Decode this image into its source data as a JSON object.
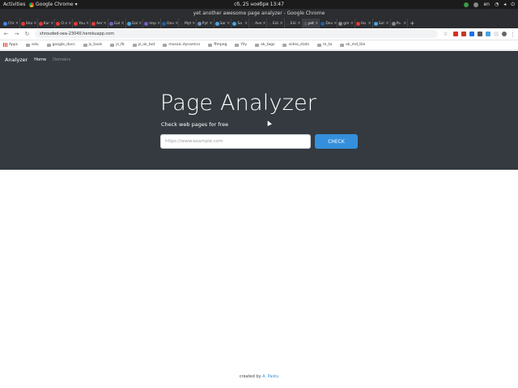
{
  "system": {
    "activities": "Activities",
    "app_name": "Google Chrome",
    "clock": "сб, 25 ноября 13:47",
    "lang": "en"
  },
  "browser": {
    "window_title": "yet another awesome page analyzer - Google Chrome",
    "tabs": [
      {
        "label": "Chr",
        "color": "#4285f4"
      },
      {
        "label": "Sho",
        "color": "#e53935"
      },
      {
        "label": "Kar",
        "color": "#e53935"
      },
      {
        "label": "O n",
        "color": "#e53935"
      },
      {
        "label": "You",
        "color": "#e53935"
      },
      {
        "label": "Aer",
        "color": "#e53935"
      },
      {
        "label": "Gal",
        "color": "#7b5cc4"
      },
      {
        "label": "Gal",
        "color": "#4aa3df"
      },
      {
        "label": "Imp",
        "color": "#7b5cc4"
      },
      {
        "label": "Dev",
        "color": "#1f5fa0"
      },
      {
        "label": "Myt",
        "color": "#333333"
      },
      {
        "label": "Pyt",
        "color": "#6c8ebf"
      },
      {
        "label": "Sar",
        "color": "#4aa3df"
      },
      {
        "label": "Sa",
        "color": "#4aa3df"
      },
      {
        "label": "Ave",
        "color": "#333333"
      },
      {
        "label": "Edi",
        "color": "#333333"
      },
      {
        "label": "Edi",
        "color": "#333333"
      },
      {
        "label": "yet",
        "color": "#555555",
        "active": true
      },
      {
        "label": "Dev",
        "color": "#1f5fa0"
      },
      {
        "label": "gm",
        "color": "#888888"
      },
      {
        "label": "Ho",
        "color": "#e53935"
      },
      {
        "label": "Sol",
        "color": "#4aa3df"
      },
      {
        "label": "Pa",
        "color": "#888888"
      }
    ],
    "url": "shrouded-sea-23040.herokuapp.com",
    "bookmarks": [
      "Apps",
      "edu",
      "google_docs",
      "js_tools",
      "js_fb",
      "js_ok_bot",
      "mosaic.dynamics",
      "ffmpeg",
      "Yily",
      "ok_tags",
      "video_stats",
      "m_ta",
      "ok_md_tile"
    ]
  },
  "page": {
    "navbar": {
      "brand": "Analyzer",
      "links": [
        "Home",
        "Domains"
      ]
    },
    "hero": {
      "title": "Page Analyzer",
      "subtitle": "Check web pages for free",
      "input_placeholder": "https://www.example.com",
      "button_label": "CHECK"
    },
    "footer": {
      "prefix": "created by",
      "author": "A. Pastu"
    }
  }
}
